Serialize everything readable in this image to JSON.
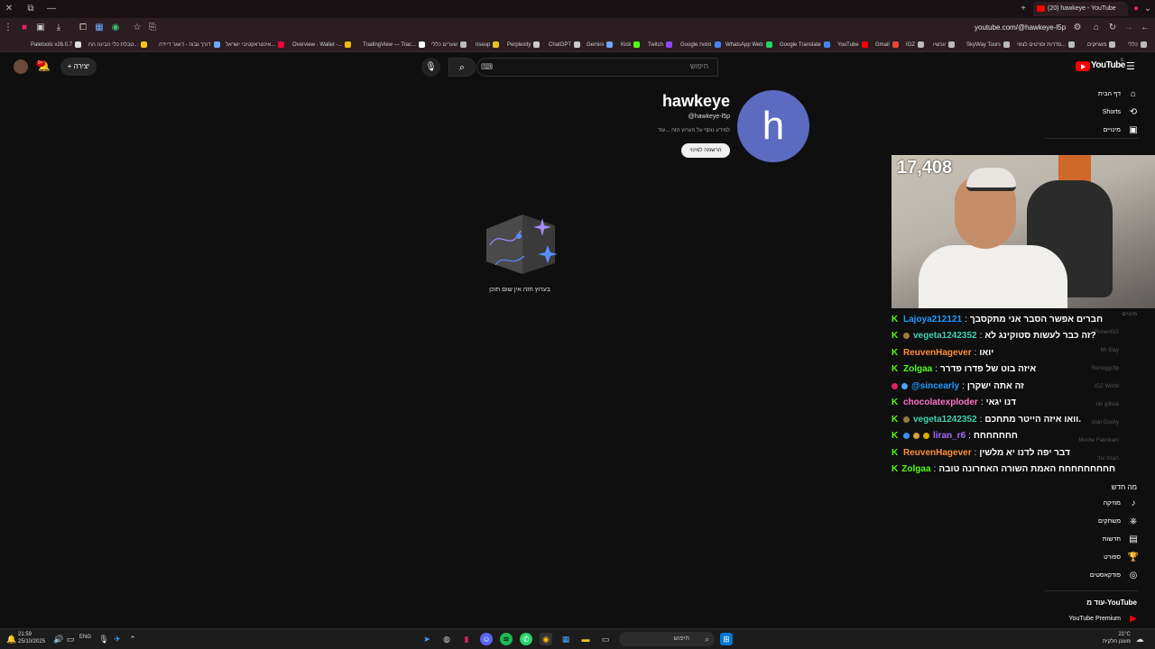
{
  "browser": {
    "tab_title": "(20) hawkeye - YouTube",
    "url": "youtube.com/@hawkeye-l5p",
    "bookmarks": [
      "Paletools v26.0.7",
      "טבלת כלי הבינה הח...",
      "דורך גבוה - דאגר דיידה",
      "אינטראקטיבי ישראל...",
      "Overview - Wallet -...",
      "TradingView — Trac...",
      "שערים כללי",
      "riseup",
      "Perplexity",
      "ChatGPT",
      "Gemini",
      "Kick",
      "Twitch",
      "Google מפות",
      "WhatsApp Web",
      "Google Translate",
      "YouTube",
      "Gmail",
      "IGZ",
      "עכשיו",
      "SkyWay Tours",
      "סדרות וסרטים לצפי...",
      "משחקים",
      "כללי"
    ]
  },
  "youtube": {
    "logo": "YouTube",
    "logo_region": "IL",
    "search_placeholder": "חיפוש",
    "create_label": "יצירה",
    "notifications_count": "9+",
    "sidebar_top": [
      {
        "label": "דף הבית",
        "icon": "home-icon"
      },
      {
        "label": "Shorts",
        "icon": "shorts-icon"
      },
      {
        "label": "מינויים",
        "icon": "subscriptions-icon"
      }
    ],
    "sidebar_explore_title": "מה חדש",
    "sidebar_explore": [
      {
        "label": "מוזיקה",
        "icon": "music-icon"
      },
      {
        "label": "משחקים",
        "icon": "gaming-icon"
      },
      {
        "label": "חדשות",
        "icon": "news-icon"
      },
      {
        "label": "ספורט",
        "icon": "trophy-icon"
      },
      {
        "label": "פודקאסטים",
        "icon": "podcast-icon"
      }
    ],
    "sidebar_more_title": "עוד מ-YouTube",
    "sidebar_more": [
      {
        "label": "YouTube Premium",
        "icon": "youtube-premium-icon"
      }
    ],
    "subscriptions_title": "מינויים",
    "subscriptions": [
      "RonenGG",
      "Mr Elay",
      "Roneggcfip",
      "IGZ World",
      "niv gilboa",
      "idan Dushy",
      "Moshe Fabrikant",
      "הצגת עוד"
    ]
  },
  "channel": {
    "avatar_letter": "h",
    "name": "hawkeye",
    "handle": "@hawkeye-l5p",
    "description": "למידע נוסף על הערוץ הזה ...עוד",
    "subscribe_label": "הרשמה למינוי",
    "empty_message": "בערוץ הזה אין שום תוכן"
  },
  "stream": {
    "viewer_count": "17,408"
  },
  "chat": [
    {
      "user": "Lajoya212121",
      "color": "#1e9bff",
      "badges": [],
      "text": "חברים אפשר הסבר אני מתקסבך"
    },
    {
      "user": "vegeta1242352",
      "color": "#3cd3b0",
      "badges": [
        "#9b7a3b"
      ],
      "text": "?זה כבר לעשות סטוקינג לא"
    },
    {
      "user": "ReuvenHagever",
      "color": "#ff8c3a",
      "badges": [],
      "text": "יואו"
    },
    {
      "user": "Zolgaa",
      "color": "#53fc18",
      "badges": [],
      "text": "איזה בוט של פדרו פדרר"
    },
    {
      "user": "@sincearly",
      "color": "#1e9bff",
      "badges": [
        "#e0245e",
        "#4aa3ff"
      ],
      "text": "זה אתה ישקרן"
    },
    {
      "user": "chocolatexploder",
      "color": "#ff73c8",
      "badges": [],
      "text": "דנו יגאי"
    },
    {
      "user": "vegeta1242352",
      "color": "#3cd3b0",
      "badges": [
        "#9b7a3b"
      ],
      "text": ".וואו איזה הייטר מתחכם"
    },
    {
      "user": "liran_r6",
      "color": "#a66bff",
      "badges": [
        "#3b8fff",
        "#d4a43b",
        "#e0a800"
      ],
      "text": "חחחחחחח"
    },
    {
      "user": "ReuvenHagever",
      "color": "#ff8c3a",
      "badges": [],
      "text": "דבר יפה לדנו יא מלשין"
    },
    {
      "user": "Zolgaa",
      "color": "#53fc18",
      "badges": [],
      "text": "חחחחחחחחח האמת השורה האחרונה טובה"
    }
  ],
  "taskbar": {
    "time": "21:59",
    "date": "25/10/2025",
    "language": "ENG",
    "search_placeholder": "חיפוש",
    "weather_temp": "21°C",
    "weather_desc": "מעונן חלקית"
  }
}
